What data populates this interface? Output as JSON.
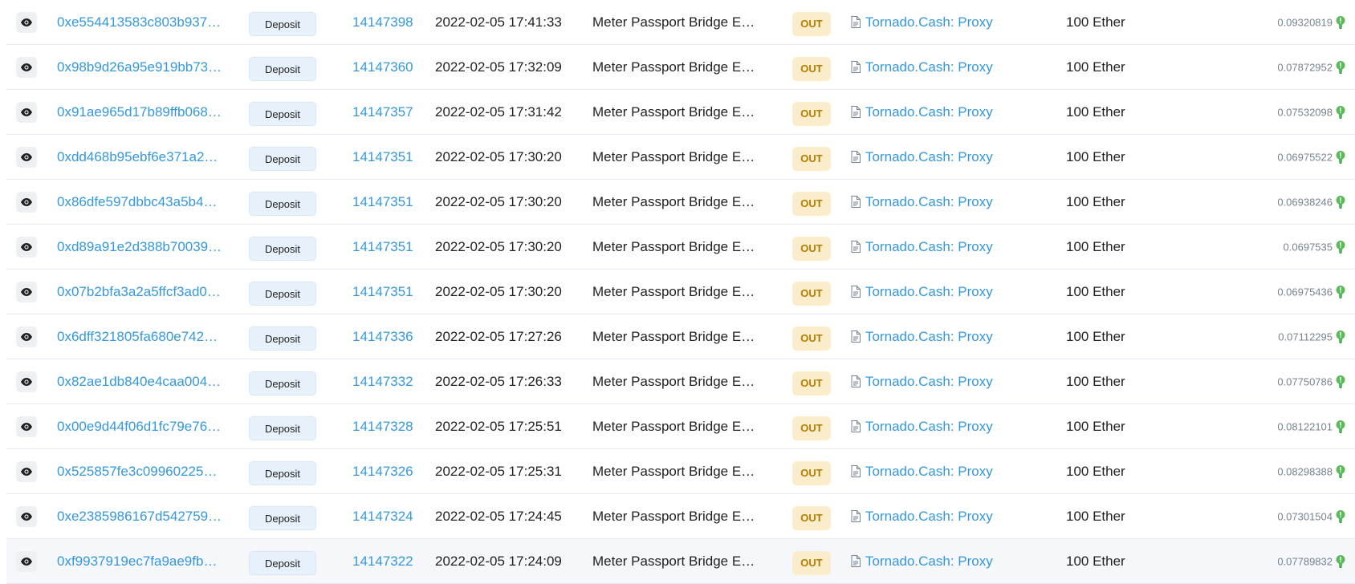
{
  "icons": {
    "view": "eye-icon",
    "contract": "document-icon",
    "gas": "lightbulb-icon"
  },
  "colors": {
    "link": "#3498db",
    "out_badge_bg": "#fbeccb",
    "out_badge_text": "#b47d00",
    "method_badge_bg": "#e7f1fb",
    "gas_icon": "#5cb85c"
  },
  "transactions": [
    {
      "hash": "0xe554413583c803b937…",
      "method": "Deposit",
      "block": "14147398",
      "age": "2022-02-05 17:41:33",
      "from": "Meter Passport Bridge E…",
      "direction": "OUT",
      "to": "Tornado.Cash: Proxy",
      "value": "100 Ether",
      "fee": "0.09320819"
    },
    {
      "hash": "0x98b9d26a95e919bb73…",
      "method": "Deposit",
      "block": "14147360",
      "age": "2022-02-05 17:32:09",
      "from": "Meter Passport Bridge E…",
      "direction": "OUT",
      "to": "Tornado.Cash: Proxy",
      "value": "100 Ether",
      "fee": "0.07872952"
    },
    {
      "hash": "0x91ae965d17b89ffb068…",
      "method": "Deposit",
      "block": "14147357",
      "age": "2022-02-05 17:31:42",
      "from": "Meter Passport Bridge E…",
      "direction": "OUT",
      "to": "Tornado.Cash: Proxy",
      "value": "100 Ether",
      "fee": "0.07532098"
    },
    {
      "hash": "0xdd468b95ebf6e371a2…",
      "method": "Deposit",
      "block": "14147351",
      "age": "2022-02-05 17:30:20",
      "from": "Meter Passport Bridge E…",
      "direction": "OUT",
      "to": "Tornado.Cash: Proxy",
      "value": "100 Ether",
      "fee": "0.06975522"
    },
    {
      "hash": "0x86dfe597dbbc43a5b4…",
      "method": "Deposit",
      "block": "14147351",
      "age": "2022-02-05 17:30:20",
      "from": "Meter Passport Bridge E…",
      "direction": "OUT",
      "to": "Tornado.Cash: Proxy",
      "value": "100 Ether",
      "fee": "0.06938246"
    },
    {
      "hash": "0xd89a91e2d388b70039…",
      "method": "Deposit",
      "block": "14147351",
      "age": "2022-02-05 17:30:20",
      "from": "Meter Passport Bridge E…",
      "direction": "OUT",
      "to": "Tornado.Cash: Proxy",
      "value": "100 Ether",
      "fee": "0.0697535"
    },
    {
      "hash": "0x07b2bfa3a2a5ffcf3ad0…",
      "method": "Deposit",
      "block": "14147351",
      "age": "2022-02-05 17:30:20",
      "from": "Meter Passport Bridge E…",
      "direction": "OUT",
      "to": "Tornado.Cash: Proxy",
      "value": "100 Ether",
      "fee": "0.06975436"
    },
    {
      "hash": "0x6dff321805fa680e742…",
      "method": "Deposit",
      "block": "14147336",
      "age": "2022-02-05 17:27:26",
      "from": "Meter Passport Bridge E…",
      "direction": "OUT",
      "to": "Tornado.Cash: Proxy",
      "value": "100 Ether",
      "fee": "0.07112295"
    },
    {
      "hash": "0x82ae1db840e4caa004…",
      "method": "Deposit",
      "block": "14147332",
      "age": "2022-02-05 17:26:33",
      "from": "Meter Passport Bridge E…",
      "direction": "OUT",
      "to": "Tornado.Cash: Proxy",
      "value": "100 Ether",
      "fee": "0.07750786"
    },
    {
      "hash": "0x00e9d44f06d1fc79e76…",
      "method": "Deposit",
      "block": "14147328",
      "age": "2022-02-05 17:25:51",
      "from": "Meter Passport Bridge E…",
      "direction": "OUT",
      "to": "Tornado.Cash: Proxy",
      "value": "100 Ether",
      "fee": "0.08122101"
    },
    {
      "hash": "0x525857fe3c09960225…",
      "method": "Deposit",
      "block": "14147326",
      "age": "2022-02-05 17:25:31",
      "from": "Meter Passport Bridge E…",
      "direction": "OUT",
      "to": "Tornado.Cash: Proxy",
      "value": "100 Ether",
      "fee": "0.08298388"
    },
    {
      "hash": "0xe2385986167d542759…",
      "method": "Deposit",
      "block": "14147324",
      "age": "2022-02-05 17:24:45",
      "from": "Meter Passport Bridge E…",
      "direction": "OUT",
      "to": "Tornado.Cash: Proxy",
      "value": "100 Ether",
      "fee": "0.07301504"
    },
    {
      "hash": "0xf9937919ec7fa9ae9fb…",
      "method": "Deposit",
      "block": "14147322",
      "age": "2022-02-05 17:24:09",
      "from": "Meter Passport Bridge E…",
      "direction": "OUT",
      "to": "Tornado.Cash: Proxy",
      "value": "100 Ether",
      "fee": "0.07789832"
    }
  ]
}
